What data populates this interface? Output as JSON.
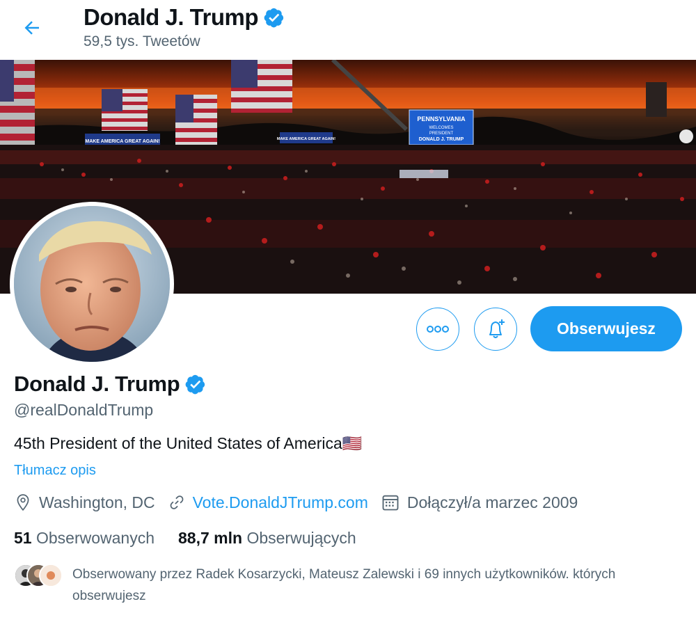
{
  "header": {
    "title": "Donald J. Trump",
    "subtitle": "59,5 tys. Tweetów",
    "back_icon": "arrow-left-icon"
  },
  "banner": {
    "signs": [
      "MAKE AMERICA GREAT AGAIN!",
      "MAKE AMERICA GREAT AGAIN!"
    ],
    "stage_sign": [
      "PENNSYLVANIA",
      "WELCOMES",
      "PRESIDENT",
      "DONALD J. TRUMP"
    ]
  },
  "actions": {
    "more_icon": "more-icon",
    "notify_icon": "bell-plus-icon",
    "follow_label": "Obserwujesz"
  },
  "profile": {
    "name": "Donald J. Trump",
    "handle": "@realDonaldTrump",
    "bio": "45th President of the United States of America",
    "bio_flag": "🇺🇸",
    "translate_label": "Tłumacz opis",
    "location": "Washington, DC",
    "website": "Vote.DonaldJTrump.com",
    "joined": "Dołączył/a marzec 2009"
  },
  "stats": {
    "following_count": "51",
    "following_label": "Obserwowanych",
    "followers_count": "88,7 mln",
    "followers_label": "Obserwujących"
  },
  "followed_by": {
    "text": "Obserwowany przez Radek Kosarzycki, Mateusz Zalewski i 69 innych użytkowników. których obserwujesz"
  },
  "colors": {
    "accent": "#1d9bf0",
    "secondary_text": "#536471",
    "primary_text": "#0f1419"
  }
}
